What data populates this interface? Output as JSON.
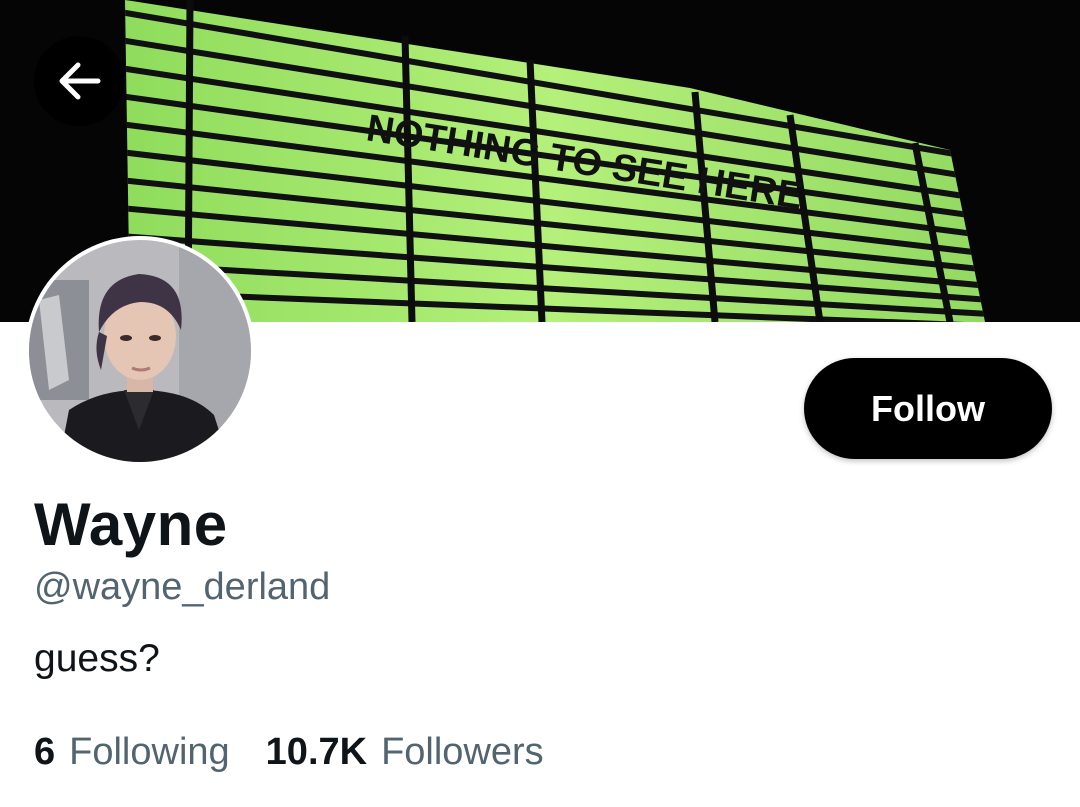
{
  "banner": {
    "marquee_text": "NOTHING TO SEE HERE",
    "colors": {
      "background": "#050505",
      "sign": "#9ee86a",
      "sign_dark": "#6fbf3f"
    }
  },
  "navigation": {
    "back_icon": "arrow-left-icon"
  },
  "profile": {
    "display_name": "Wayne",
    "handle": "@wayne_derland",
    "bio": "guess?"
  },
  "actions": {
    "follow_label": "Follow"
  },
  "stats": {
    "following_count": "6",
    "following_label": "Following",
    "followers_count": "10.7K",
    "followers_label": "Followers"
  }
}
